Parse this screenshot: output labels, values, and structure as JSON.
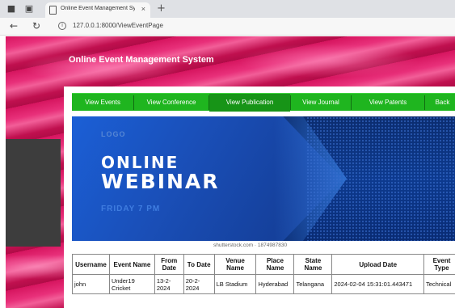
{
  "browser": {
    "tab_title": "Online Event Management Syst",
    "tab_close": "×",
    "new_tab": "+",
    "url": "127.0.0.1:8000/ViewEventPage"
  },
  "site": {
    "title": "Online Event Management System"
  },
  "nav": {
    "items": [
      "View Events",
      "View Conference",
      "View Publication",
      "View Journal",
      "View Patents",
      "Back"
    ]
  },
  "banner": {
    "logo": "LOGO",
    "line1": "ONLINE",
    "line2": "WEBINAR",
    "line3": "FRIDAY  7 PM",
    "credit": "shutterstock.com · 1874987830"
  },
  "table": {
    "headers": [
      "Username",
      "Event Name",
      "From Date",
      "To Date",
      "Venue Name",
      "Place Name",
      "State Name",
      "Upload Date",
      "Event Type"
    ],
    "rows": [
      [
        "john",
        "Under19 Cricket",
        "13-2-2024",
        "20-2-2024",
        "LB Stadium",
        "Hyderabad",
        "Telangana",
        "2024-02-04 15:31:01.443471",
        "Technical"
      ]
    ]
  },
  "colors": {
    "navbar": "#1fb51f",
    "background": "#d6155f",
    "banner": "#0d3a8f"
  }
}
